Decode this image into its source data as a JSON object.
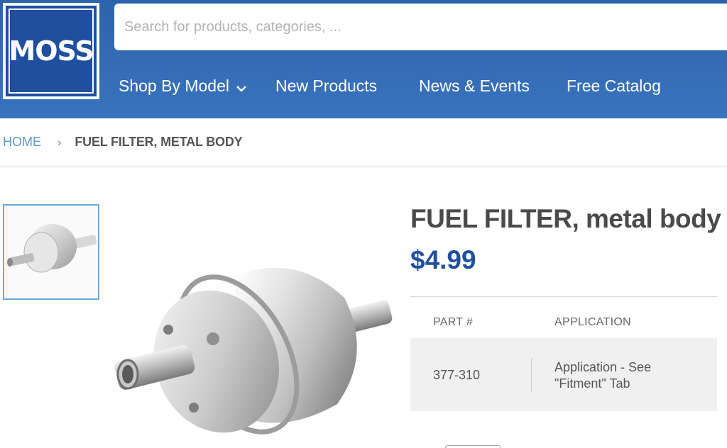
{
  "header": {
    "logo_text": "MOSS",
    "search_placeholder": "Search for products, categories, ...",
    "nav": [
      {
        "label": "Shop By Model",
        "has_dropdown": true
      },
      {
        "label": "New Products"
      },
      {
        "label": "News & Events"
      },
      {
        "label": "Free Catalog"
      }
    ]
  },
  "breadcrumb": {
    "home": "HOME",
    "separator": "›",
    "current": "FUEL FILTER, METAL BODY"
  },
  "product": {
    "title": "FUEL FILTER, metal body",
    "price": "$4.99",
    "table": {
      "headers": [
        "PART #",
        "APPLICATION"
      ],
      "rows": [
        {
          "part": "377-310",
          "application": "Application - See \"Fitment\" Tab"
        }
      ]
    }
  },
  "colors": {
    "header_blue": "#3a73bd",
    "brand_dark_blue": "#1f4f9e",
    "link_blue": "#5b9bd5",
    "thumb_border": "#6fa8dc"
  },
  "icons": {
    "nav_dropdown": "chevron-down-icon",
    "breadcrumb_sep": "chevron-right-icon"
  }
}
